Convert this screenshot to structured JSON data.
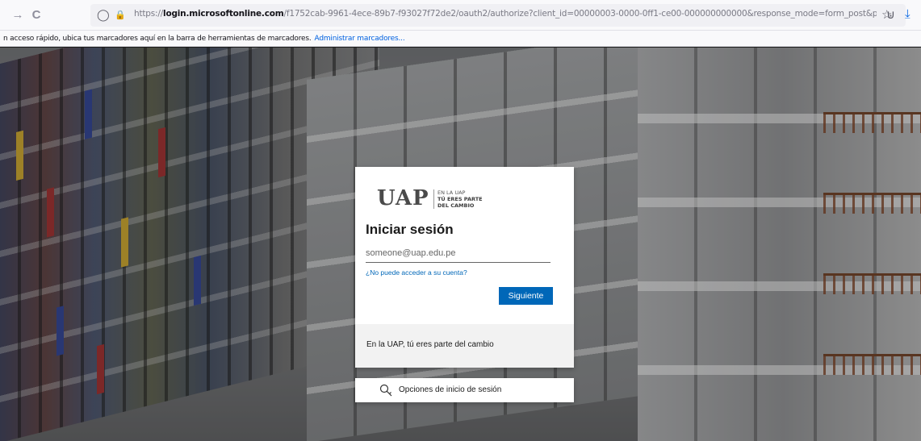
{
  "browser": {
    "url_prefix": "https://",
    "url_host": "login.microsoftonline.com",
    "url_rest": "/f1752cab-9961-4ece-89b7-f93027f72de2/oauth2/authorize?client_id=00000003-0000-0ff1-ce00-000000000000&response_mode=form_post&protectedtoken=true&response_type=code",
    "bookmarks_hint": "n acceso rápido, ubica tus marcadores aquí en la barra de herramientas de marcadores.",
    "bookmarks_link": "Administrar marcadores..."
  },
  "icons": {
    "forward": "→",
    "reload": "C",
    "shield": "◯",
    "lock": "🔒",
    "star": "☆",
    "pocket": "⊍",
    "download": "⤓"
  },
  "login": {
    "logo_mark": "UAP",
    "logo_tag_line1": "EN LA UAP",
    "logo_tag_line2": "TÚ ERES PARTE",
    "logo_tag_line3": "DEL CAMBIO",
    "title": "Iniciar sesión",
    "email_placeholder": "someone@uap.edu.pe",
    "email_value": "",
    "cant_access": "¿No puede acceder a su cuenta?",
    "next_button": "Siguiente",
    "footer_text": "En la UAP, tú eres parte del cambio"
  },
  "sign_in_options": {
    "label": "Opciones de inicio de sesión"
  },
  "colors": {
    "accent": "#0067b8",
    "link": "#0061e0"
  }
}
